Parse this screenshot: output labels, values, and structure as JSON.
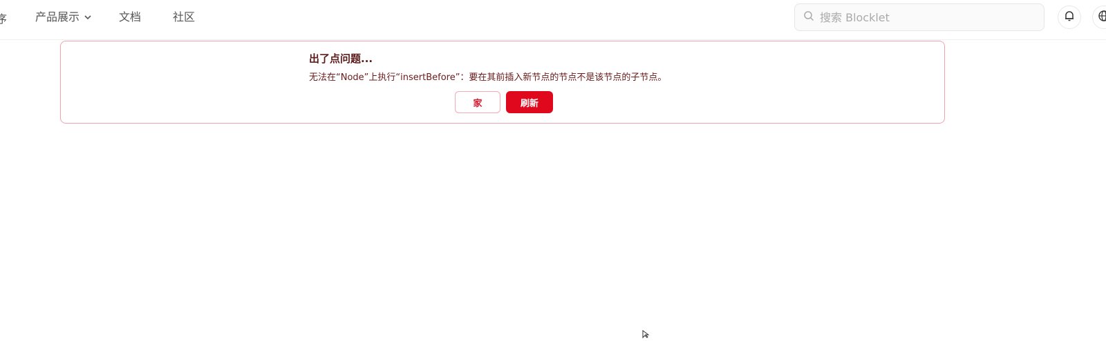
{
  "header": {
    "nav_cut_text": "序",
    "nav": [
      {
        "label": "产品展示",
        "has_dropdown": true
      },
      {
        "label": "文档"
      },
      {
        "label": "社区"
      }
    ],
    "search": {
      "placeholder": "搜索 Blocklet",
      "icon": "search-icon"
    },
    "icons": [
      "bell-icon",
      "globe-icon"
    ]
  },
  "error": {
    "title": "出了点问题...",
    "message": "无法在“Node”上执行“insertBefore”：要在其前插入新节点的节点不是该节点的子节点。",
    "buttons": {
      "home_label": "家",
      "refresh_label": "刷新"
    },
    "colors": {
      "border": "#f0a3ab",
      "primary": "#e0081d",
      "title": "#5a1a1a"
    }
  }
}
